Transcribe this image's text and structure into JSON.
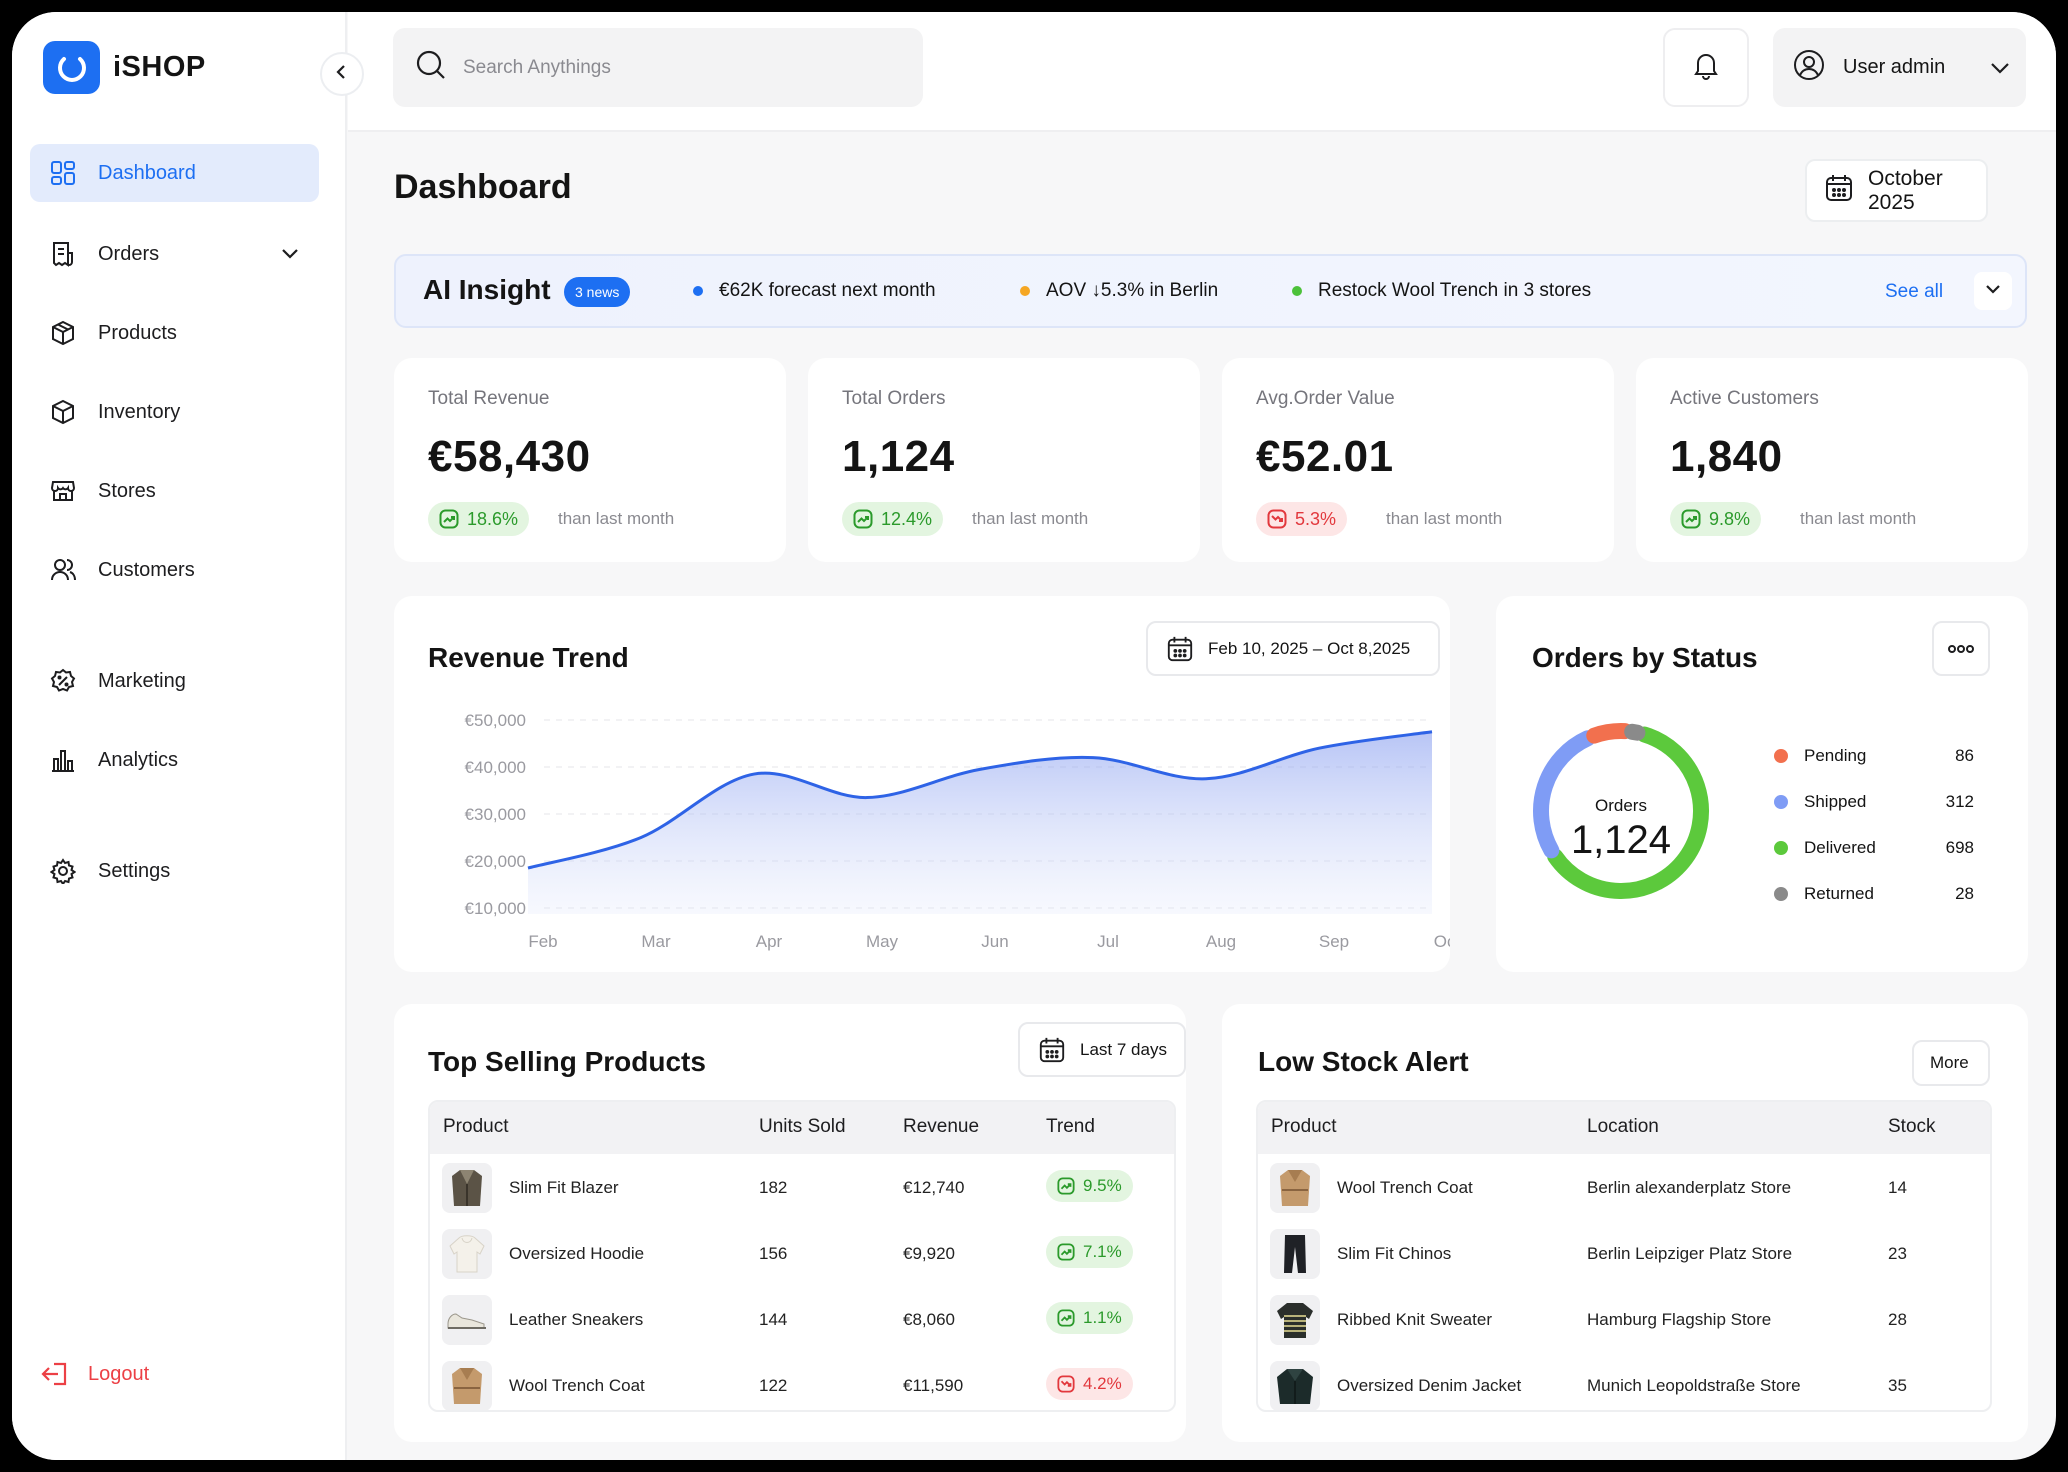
{
  "app": {
    "name": "iSHOP"
  },
  "sidebar": {
    "items": [
      {
        "label": "Dashboard",
        "icon": "dashboard-icon",
        "active": true
      },
      {
        "label": "Orders",
        "icon": "receipt-icon"
      },
      {
        "label": "Products",
        "icon": "package-icon"
      },
      {
        "label": "Inventory",
        "icon": "box-icon"
      },
      {
        "label": "Stores",
        "icon": "store-icon"
      },
      {
        "label": "Customers",
        "icon": "users-icon"
      },
      {
        "label": "Marketing",
        "icon": "discount-icon"
      },
      {
        "label": "Analytics",
        "icon": "bar-chart-icon"
      },
      {
        "label": "Settings",
        "icon": "gear-icon"
      }
    ],
    "logout": "Logout"
  },
  "topbar": {
    "search_placeholder": "Search Anythings",
    "user": "User admin"
  },
  "page": {
    "title": "Dashboard",
    "date": "October 2025"
  },
  "insight": {
    "title": "AI Insight",
    "badge": "3 news",
    "items": [
      {
        "text": "€62K forecast next month",
        "color": "#1d6ff2"
      },
      {
        "text": "AOV ↓5.3% in Berlin",
        "color": "#f5a623"
      },
      {
        "text": "Restock Wool Trench in 3 stores",
        "color": "#4cc13a"
      }
    ],
    "see_all": "See all"
  },
  "kpis": [
    {
      "label": "Total Revenue",
      "value": "€58,430",
      "change": "18.6%",
      "direction": "up",
      "note": "than last month"
    },
    {
      "label": "Total Orders",
      "value": "1,124",
      "change": "12.4%",
      "direction": "up",
      "note": "than last month"
    },
    {
      "label": "Avg.Order Value",
      "value": "€52.01",
      "change": "5.3%",
      "direction": "down",
      "note": "than last month"
    },
    {
      "label": "Active Customers",
      "value": "1,840",
      "change": "9.8%",
      "direction": "up",
      "note": "than last month"
    }
  ],
  "revenue_trend": {
    "title": "Revenue Trend",
    "range": "Feb 10, 2025 – Oct 8,2025"
  },
  "orders_status": {
    "title": "Orders by Status",
    "center_label": "Orders",
    "center_value": "1,124",
    "rows": [
      {
        "label": "Pending",
        "value": "86",
        "color": "#f2704e"
      },
      {
        "label": "Shipped",
        "value": "312",
        "color": "#7f9cf5"
      },
      {
        "label": "Delivered",
        "value": "698",
        "color": "#5cc93c"
      },
      {
        "label": "Returned",
        "value": "28",
        "color": "#8a8a8a"
      }
    ]
  },
  "chart_data": [
    {
      "type": "area",
      "title": "Revenue Trend",
      "categories": [
        "Feb",
        "Mar",
        "Apr",
        "May",
        "Jun",
        "Jul",
        "Aug",
        "Sep",
        "Oct"
      ],
      "values": [
        18500,
        25000,
        38500,
        33500,
        39500,
        42000,
        37500,
        44000,
        47500
      ],
      "y_ticks": [
        "€50,000",
        "€40,000",
        "€30,000",
        "€20,000",
        "€10,000"
      ],
      "ylim": [
        10000,
        50000
      ],
      "color": "#2e63e6"
    },
    {
      "type": "pie",
      "title": "Orders by Status",
      "categories": [
        "Pending",
        "Shipped",
        "Delivered",
        "Returned"
      ],
      "values": [
        86,
        312,
        698,
        28
      ]
    }
  ],
  "top_selling": {
    "title": "Top Selling Products",
    "filter": "Last 7 days",
    "columns": [
      "Product",
      "Units Sold",
      "Revenue",
      "Trend"
    ],
    "rows": [
      {
        "product": "Slim Fit Blazer",
        "units": "182",
        "revenue": "€12,740",
        "trend": "9.5%",
        "direction": "up",
        "thumb": "blazer-icon"
      },
      {
        "product": "Oversized Hoodie",
        "units": "156",
        "revenue": "€9,920",
        "trend": "7.1%",
        "direction": "up",
        "thumb": "hoodie-icon"
      },
      {
        "product": "Leather Sneakers",
        "units": "144",
        "revenue": "€8,060",
        "trend": "1.1%",
        "direction": "up",
        "thumb": "sneaker-icon"
      },
      {
        "product": "Wool Trench Coat",
        "units": "122",
        "revenue": "€11,590",
        "trend": "4.2%",
        "direction": "down",
        "thumb": "coat-icon"
      }
    ]
  },
  "low_stock": {
    "title": "Low Stock Alert",
    "more": "More",
    "columns": [
      "Product",
      "Location",
      "Stock"
    ],
    "rows": [
      {
        "product": "Wool Trench Coat",
        "location": "Berlin alexanderplatz Store",
        "stock": "14",
        "thumb": "coat-icon"
      },
      {
        "product": "Slim Fit Chinos",
        "location": "Berlin Leipziger Platz Store",
        "stock": "23",
        "thumb": "trousers-icon"
      },
      {
        "product": "Ribbed Knit Sweater",
        "location": "Hamburg Flagship Store",
        "stock": "28",
        "thumb": "sweater-icon"
      },
      {
        "product": "Oversized Denim Jacket",
        "location": "Munich Leopoldstraße Store",
        "stock": "35",
        "thumb": "jacket-icon"
      }
    ]
  }
}
